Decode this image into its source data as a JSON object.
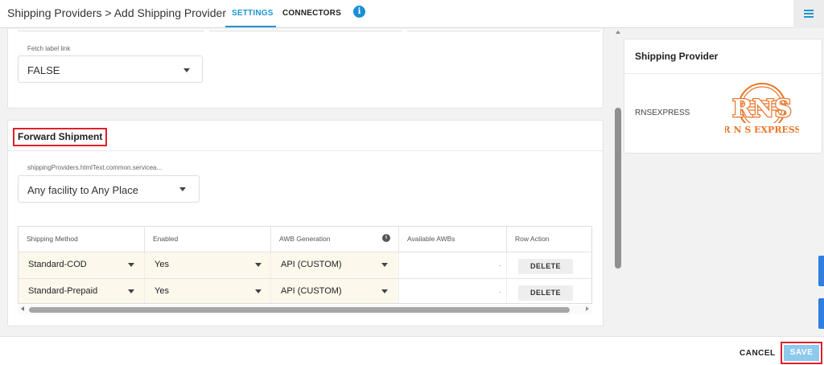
{
  "header": {
    "breadcrumb": "Shipping Providers > Add Shipping Provider",
    "tabs": [
      {
        "label": "SETTINGS",
        "active": true
      },
      {
        "label": "CONNECTORS",
        "active": false
      }
    ],
    "info_glyph": "i",
    "accent_color": "#2196d3"
  },
  "general": {
    "fetch_label_link": {
      "label": "Fetch label link",
      "value": "FALSE"
    }
  },
  "forward_shipment": {
    "title": "Forward Shipment",
    "serviceability": {
      "label": "shippingProviders.htmlText.common.servicea...",
      "value": "Any facility to Any Place"
    },
    "table": {
      "columns": [
        "Shipping Method",
        "Enabled",
        "AWB Generation",
        "Available AWBs",
        "Row Action"
      ],
      "awb_info_glyph": "i",
      "rows": [
        {
          "method": "Standard-COD",
          "enabled": "Yes",
          "awb_generation": "API (CUSTOM)",
          "available_awbs": "-",
          "action": "DELETE"
        },
        {
          "method": "Standard-Prepaid",
          "enabled": "Yes",
          "awb_generation": "API (CUSTOM)",
          "available_awbs": "-",
          "action": "DELETE"
        }
      ]
    }
  },
  "side_panel": {
    "title": "Shipping Provider",
    "provider_name": "RNSEXPRESS",
    "logo": {
      "monogram": "RNS",
      "text": "R N S EXPRESS",
      "color": "#e8762b"
    }
  },
  "footer": {
    "cancel_label": "CANCEL",
    "save_label": "SAVE",
    "highlight_color": "#e0202a"
  }
}
